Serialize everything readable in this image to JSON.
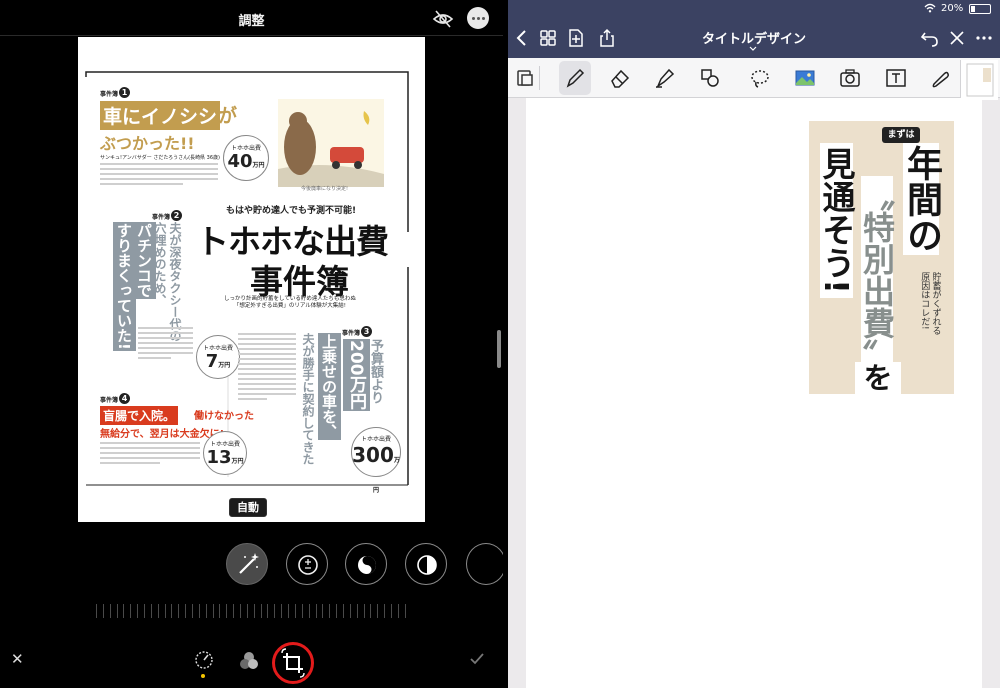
{
  "left": {
    "title": "調整",
    "auto_badge": "自動",
    "magazine": {
      "case1_label": "事件簿",
      "case1_num": "1",
      "case1_title_bar": "車にイノシシ",
      "case1_title_ga": "が",
      "case1_title_line2": "ぶつかった!!",
      "case1_person": "サンキュ!アンバサダー さだたろうさん(長崎県 36歳)",
      "case1_circle_label": "トホホ出費",
      "case1_circle_value": "40",
      "case1_circle_unit": "万円",
      "case1_caption": "今後廃車になり決定!",
      "headline_lead": "もはや貯め達人でも予測不可能!",
      "headline_line1": "トホホな出費",
      "headline_line2": "事件簿",
      "headline_sub": "しっかり計画的貯蓄をしている貯め達人たちも思わぬ\n「想定外すぎる出費」のリアル体験が大集結!",
      "case2_label": "事件簿",
      "case2_num": "2",
      "case2_col1": "夫が深夜タクシー代の",
      "case2_col2": "穴埋めのため、",
      "case2_col3": "パチンコで",
      "case2_col4": "すりまくっていた!",
      "case2_circle_label": "トホホ出費",
      "case2_circle_value": "7",
      "case2_circle_unit": "万円",
      "case3_label": "事件簿",
      "case3_num": "3",
      "case3_col1": "予算額より",
      "case3_col2": "200万円",
      "case3_col3": "上乗せの車を、",
      "case3_col4": "夫が勝手に契約してきた",
      "case3_circle_label": "トホホ出費",
      "case3_circle_value": "300",
      "case3_circle_unit": "万円",
      "case4_label": "事件簿",
      "case4_num": "4",
      "case4_title_bar": "盲腸で入院。",
      "case4_title_tail": "働けなかった",
      "case4_title_line2": "無給分で、翌月は大金欠に!",
      "case4_circle_label": "トホホ出費",
      "case4_circle_value": "13",
      "case4_circle_unit": "万円"
    }
  },
  "right": {
    "battery_pct": "20%",
    "doc_title": "タイトルデザイン",
    "card": {
      "badge": "まずは",
      "col1": "年間の",
      "col2": "〝特別出費〟",
      "col3": "見通そう!",
      "wo": "を",
      "sub": "貯蓄がくずれる\n原因はコレだ!"
    }
  },
  "colors": {
    "accent_red": "#e31b1b",
    "nav_bg": "#3b4262",
    "mag_gold": "#c29d4f",
    "mag_slate": "#8f9aa3",
    "mag_red": "#d93b1e"
  }
}
